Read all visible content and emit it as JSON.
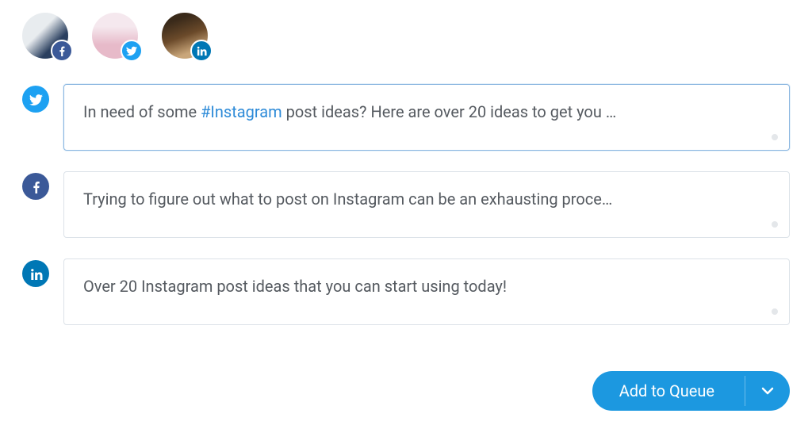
{
  "accounts": [
    {
      "network": "facebook"
    },
    {
      "network": "twitter"
    },
    {
      "network": "linkedin"
    }
  ],
  "composers": [
    {
      "network": "twitter",
      "active": true,
      "text_before_tag": "In need of some ",
      "hashtag": "#Instagram",
      "text_after_tag": " post ideas? Here are over 20 ideas to get you …"
    },
    {
      "network": "facebook",
      "active": false,
      "text": "Trying to figure out what to post on Instagram can be an exhausting proce…"
    },
    {
      "network": "linkedin",
      "active": false,
      "text": "Over 20 Instagram post ideas that you can start using today!"
    }
  ],
  "primary_button": {
    "label": "Add to Queue"
  }
}
